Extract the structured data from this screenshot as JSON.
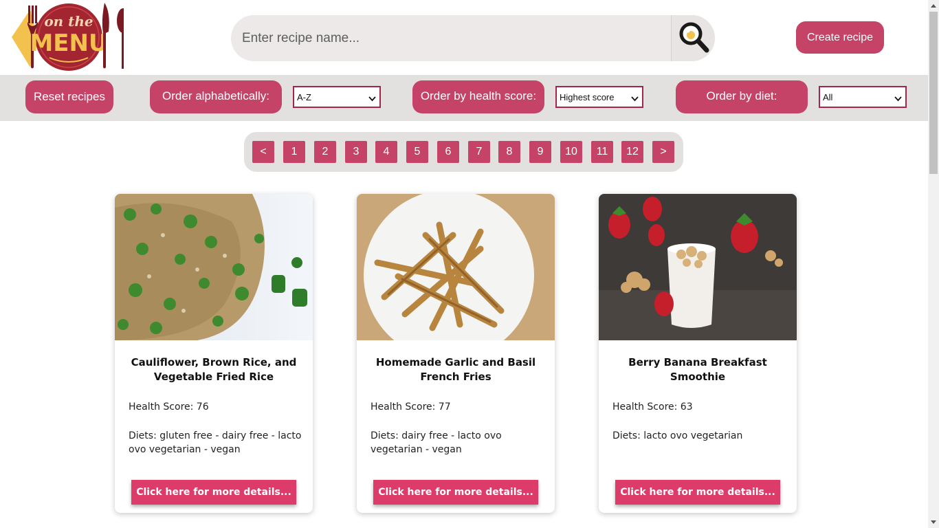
{
  "brand": {
    "logo_text": "on the MENU",
    "colors": {
      "accent": "#c44367",
      "button": "#dd3c6a",
      "logo_red": "#a3252f",
      "logo_gold": "#f2c14e"
    }
  },
  "header": {
    "search_placeholder": "Enter recipe name...",
    "search_icon": "magnifier-icon",
    "create_label": "Create recipe"
  },
  "filters": {
    "reset_label": "Reset recipes",
    "alpha_label": "Order alphabetically:",
    "alpha_value": "A-Z",
    "health_label": "Order by health score:",
    "health_value": "Highest score",
    "diet_label": "Order by diet:",
    "diet_value": "All"
  },
  "pagination": {
    "prev": "<",
    "next": ">",
    "pages": [
      "1",
      "2",
      "3",
      "4",
      "5",
      "6",
      "7",
      "8",
      "9",
      "10",
      "11",
      "12"
    ]
  },
  "recipes": [
    {
      "title": "Cauliflower, Brown Rice, and Vegetable Fried Rice",
      "health": "Health Score: 76",
      "diets": "Diets: gluten free - dairy free - lacto ovo vegetarian - vegan",
      "button": "Click here for more details..."
    },
    {
      "title": "Homemade Garlic and Basil French Fries",
      "health": "Health Score: 77",
      "diets": "Diets: dairy free - lacto ovo vegetarian - vegan",
      "button": "Click here for more details..."
    },
    {
      "title": "Berry Banana Breakfast Smoothie",
      "health": "Health Score: 63",
      "diets": "Diets: lacto ovo vegetarian",
      "button": "Click here for more details..."
    }
  ]
}
